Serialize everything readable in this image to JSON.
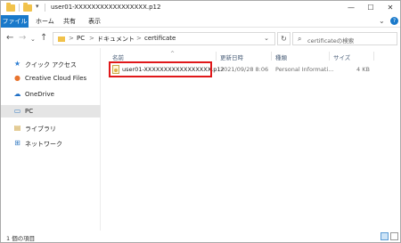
{
  "titlebar": {
    "title": "user01-XXXXXXXXXXXXXXXXX.p12",
    "dropdown_glyph": "▾",
    "minimize": "—",
    "maximize": "☐",
    "close": "✕"
  },
  "ribbon": {
    "tabs": [
      "ファイル",
      "ホーム",
      "共有",
      "表示"
    ],
    "collapse_glyph": "⌄",
    "help_glyph": "?"
  },
  "nav": {
    "back": "←",
    "forward": "→",
    "recent": "⌄",
    "up": "↑",
    "breadcrumb": [
      "PC",
      "ドキュメント",
      "certificate"
    ],
    "crumb_sep": ">",
    "address_dropdown": "⌄",
    "refresh": "↻",
    "search_icon": "⌕",
    "search_placeholder": "certificateの検索"
  },
  "sidebar": {
    "items": [
      {
        "label": "クイック アクセス",
        "icon": "★",
        "icon_name": "star-icon",
        "selected": false
      },
      {
        "label": "Creative Cloud Files",
        "icon": "●",
        "icon_name": "creative-cloud-icon",
        "selected": false
      },
      {
        "label": "OneDrive",
        "icon": "☁",
        "icon_name": "cloud-icon",
        "selected": false
      },
      {
        "label": "PC",
        "icon": "▭",
        "icon_name": "computer-icon",
        "selected": true
      },
      {
        "label": "ライブラリ",
        "icon": "▤",
        "icon_name": "library-icon",
        "selected": false
      },
      {
        "label": "ネットワーク",
        "icon": "⊞",
        "icon_name": "network-icon",
        "selected": false
      }
    ]
  },
  "file_list": {
    "columns": [
      "名前",
      "更新日時",
      "種類",
      "サイズ"
    ],
    "sort_glyph": "^",
    "rows": [
      {
        "name": "user01-XXXXXXXXXXXXXXXXX.p12",
        "modified": "2021/09/28 8:06",
        "type": "Personal Informati...",
        "size": "4 KB"
      }
    ]
  },
  "status": {
    "item_count": "1 個の項目"
  },
  "colors": {
    "accent": "#1979ca",
    "highlight_box": "#e0181a",
    "selection": "#e5e5e5",
    "folder": "#f1c24b"
  }
}
